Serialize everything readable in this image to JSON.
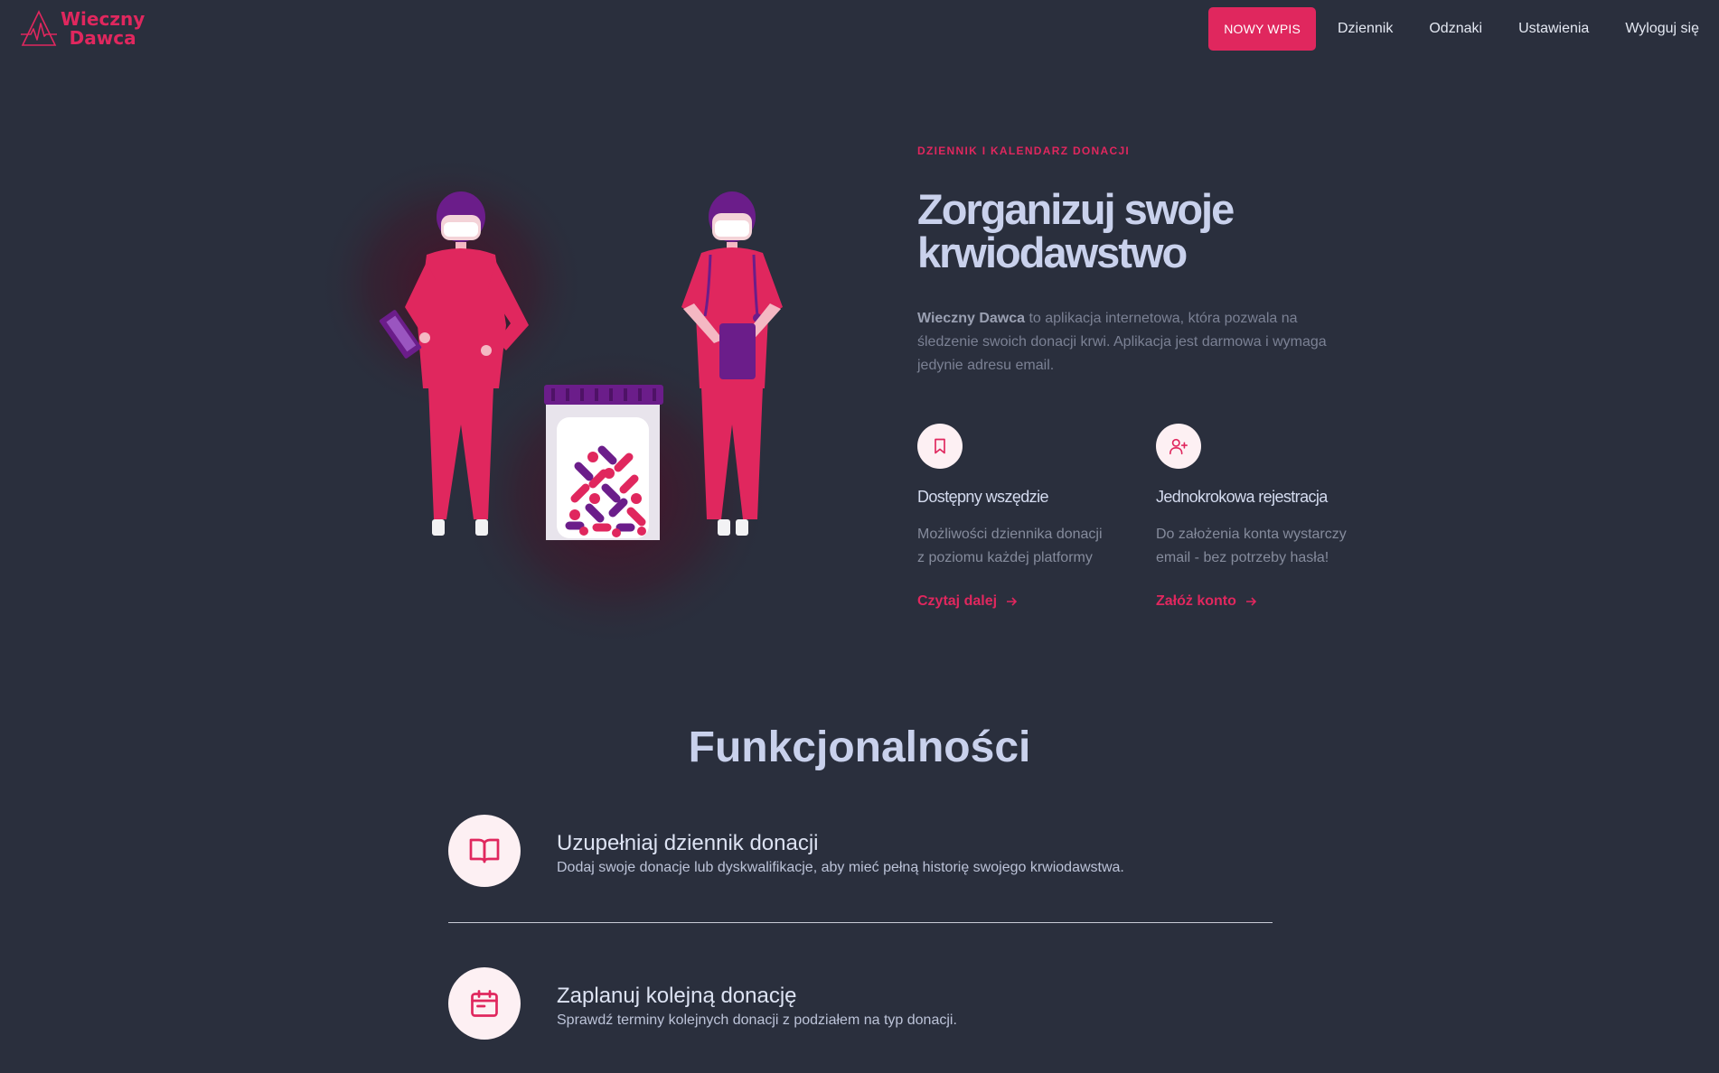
{
  "brand": {
    "line1": "Wieczny",
    "line2": "Dawca",
    "color": "#e0275e"
  },
  "nav": {
    "new_entry": "NOWY WPIS",
    "links": [
      "Dziennik",
      "Odznaki",
      "Ustawienia",
      "Wyloguj się"
    ]
  },
  "hero": {
    "eyebrow": "DZIENNIK I KALENDARZ DONACJI",
    "title_line1": "Zorganizuj swoje",
    "title_line2": "krwiodawstwo",
    "desc_bold": "Wieczny Dawca",
    "desc_rest": " to aplikacja internetowa, która pozwala na śledzenie swoich donacji krwi. Aplikacja jest darmowa i wymaga jedynie adresu email."
  },
  "mini_features": [
    {
      "icon": "bookmark-icon",
      "title": "Dostępny wszędzie",
      "desc_line1": "Możliwości dziennika donacji",
      "desc_line2": "z poziomu każdej platformy",
      "link": "Czytaj dalej"
    },
    {
      "icon": "user-plus-icon",
      "title": "Jednokrokowa rejestracja",
      "desc_line1": "Do założenia konta wystarczy",
      "desc_line2": "email - bez potrzeby hasła!",
      "link": "Załóż konto"
    }
  ],
  "section_title": "Funkcjonalności",
  "features": [
    {
      "icon": "book-open-icon",
      "title": "Uzupełniaj dziennik donacji",
      "desc": "Dodaj swoje donacje lub dyskwalifikacje, aby mieć pełną historię swojego krwiodawstwa."
    },
    {
      "icon": "calendar-icon",
      "title": "Zaplanuj kolejną donację",
      "desc": "Sprawdź terminy kolejnych donacji z podziałem na typ donacji."
    }
  ]
}
